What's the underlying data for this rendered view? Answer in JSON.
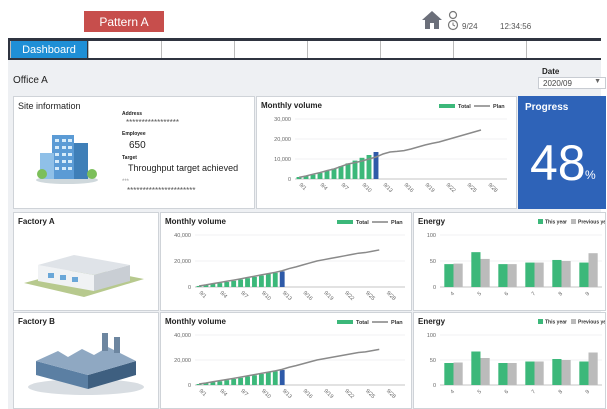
{
  "header": {
    "pattern_label": "Pattern A",
    "person_count": "9/24",
    "clock": "12:34:56"
  },
  "nav": {
    "tabs": [
      {
        "label": "Dashboard"
      },
      {
        "label": ""
      },
      {
        "label": ""
      },
      {
        "label": ""
      },
      {
        "label": ""
      },
      {
        "label": ""
      },
      {
        "label": ""
      },
      {
        "label": ""
      }
    ]
  },
  "office": {
    "name": "Office A",
    "date_label": "Date",
    "date_value": "2020/09",
    "site_title": "Site information",
    "address_label": "Address",
    "address_value": "*****************",
    "employee_label": "Employee",
    "employee_value": "650",
    "target_label": "Target",
    "target_value": "Throughput target achieved",
    "extra_label": "***",
    "extra_value": "**********************",
    "monthly_title": "Monthly volume",
    "progress_title": "Progress",
    "progress_value": "48",
    "progress_unit": "%"
  },
  "factories": [
    {
      "name": "Factory A",
      "monthly_title": "Monthly volume",
      "energy_title": "Energy"
    },
    {
      "name": "Factory B",
      "monthly_title": "Monthly volume",
      "energy_title": "Energy"
    }
  ],
  "colors": {
    "accent": "#1f8fd6",
    "progress_bg": "#2e63b8",
    "bar": "#3cb87a",
    "bar_current": "#2e5aa8",
    "plan": "#8a8a8a",
    "energy_this": "#3cb87a",
    "energy_prev": "#bbbbbb"
  },
  "chart_data": [
    {
      "type": "bar",
      "title": "Monthly volume",
      "legend": [
        "Total",
        "Plan"
      ],
      "categories": [
        "9/1",
        "9/4",
        "9/7",
        "9/10",
        "9/13",
        "9/16",
        "9/19",
        "9/22",
        "9/25",
        "9/28"
      ],
      "ylim": [
        0,
        30000
      ],
      "yticks": [
        "0",
        "10,000",
        "20,000",
        "30,000"
      ],
      "total": [
        1000,
        1500,
        2200,
        3000,
        4000,
        5200,
        6400,
        7800,
        9200,
        10600,
        12000,
        13500
      ],
      "plan": [
        800,
        1500,
        2400,
        3200,
        4200,
        5000,
        6300,
        7500,
        8200,
        9000,
        10000,
        11000,
        12500,
        13500,
        13800,
        14200,
        15000,
        16000,
        17000,
        17800,
        18500,
        19500,
        20500,
        21500,
        22500,
        23500,
        24500
      ]
    },
    {
      "type": "bar",
      "title": "Monthly volume",
      "legend": [
        "Total",
        "Plan"
      ],
      "categories": [
        "9/1",
        "9/4",
        "9/7",
        "9/10",
        "9/13",
        "9/16",
        "9/19",
        "9/22",
        "9/25",
        "9/28"
      ],
      "ylim": [
        0,
        40000
      ],
      "yticks": [
        "0",
        "20,000",
        "40,000"
      ],
      "total": [
        800,
        1500,
        2300,
        3000,
        3900,
        4800,
        5800,
        6800,
        7800,
        8800,
        10000,
        11000,
        12000
      ],
      "plan": [
        800,
        1600,
        2600,
        3500,
        4400,
        5300,
        6300,
        7300,
        8300,
        9300,
        10300,
        11300,
        12500,
        14200,
        15500,
        17000,
        18500,
        20000,
        21000,
        22000,
        23000,
        24000,
        25000,
        26000,
        26500,
        27500,
        28500
      ]
    },
    {
      "type": "bar",
      "title": "Energy",
      "legend": [
        "This year",
        "Previous year"
      ],
      "categories": [
        "4",
        "5",
        "6",
        "7",
        "8",
        "9"
      ],
      "ylim": [
        0,
        100
      ],
      "yticks": [
        "0",
        "50",
        "100"
      ],
      "this_year": [
        44,
        67,
        44,
        47,
        52,
        47
      ],
      "previous_year": [
        45,
        54,
        44,
        47,
        50,
        65
      ]
    },
    {
      "type": "bar",
      "title": "Monthly volume",
      "legend": [
        "Total",
        "Plan"
      ],
      "categories": [
        "9/1",
        "9/4",
        "9/7",
        "9/10",
        "9/13",
        "9/16",
        "9/19",
        "9/22",
        "9/25",
        "9/28"
      ],
      "ylim": [
        0,
        40000
      ],
      "yticks": [
        "0",
        "20,000",
        "40,000"
      ],
      "total": [
        800,
        1500,
        2300,
        3000,
        3900,
        4800,
        5800,
        6800,
        7800,
        8800,
        10000,
        11000,
        12000
      ],
      "plan": [
        800,
        1600,
        2600,
        3500,
        4400,
        5300,
        6300,
        7300,
        8300,
        9300,
        10300,
        11300,
        12500,
        14200,
        15500,
        17000,
        18500,
        20000,
        21000,
        22000,
        23000,
        24000,
        25000,
        26000,
        26500,
        27500,
        28500
      ]
    },
    {
      "type": "bar",
      "title": "Energy",
      "legend": [
        "This year",
        "Previous year"
      ],
      "categories": [
        "4",
        "5",
        "6",
        "7",
        "8",
        "9"
      ],
      "ylim": [
        0,
        100
      ],
      "yticks": [
        "0",
        "50",
        "100"
      ],
      "this_year": [
        44,
        67,
        44,
        47,
        52,
        47
      ],
      "previous_year": [
        45,
        54,
        44,
        47,
        50,
        65
      ]
    }
  ]
}
